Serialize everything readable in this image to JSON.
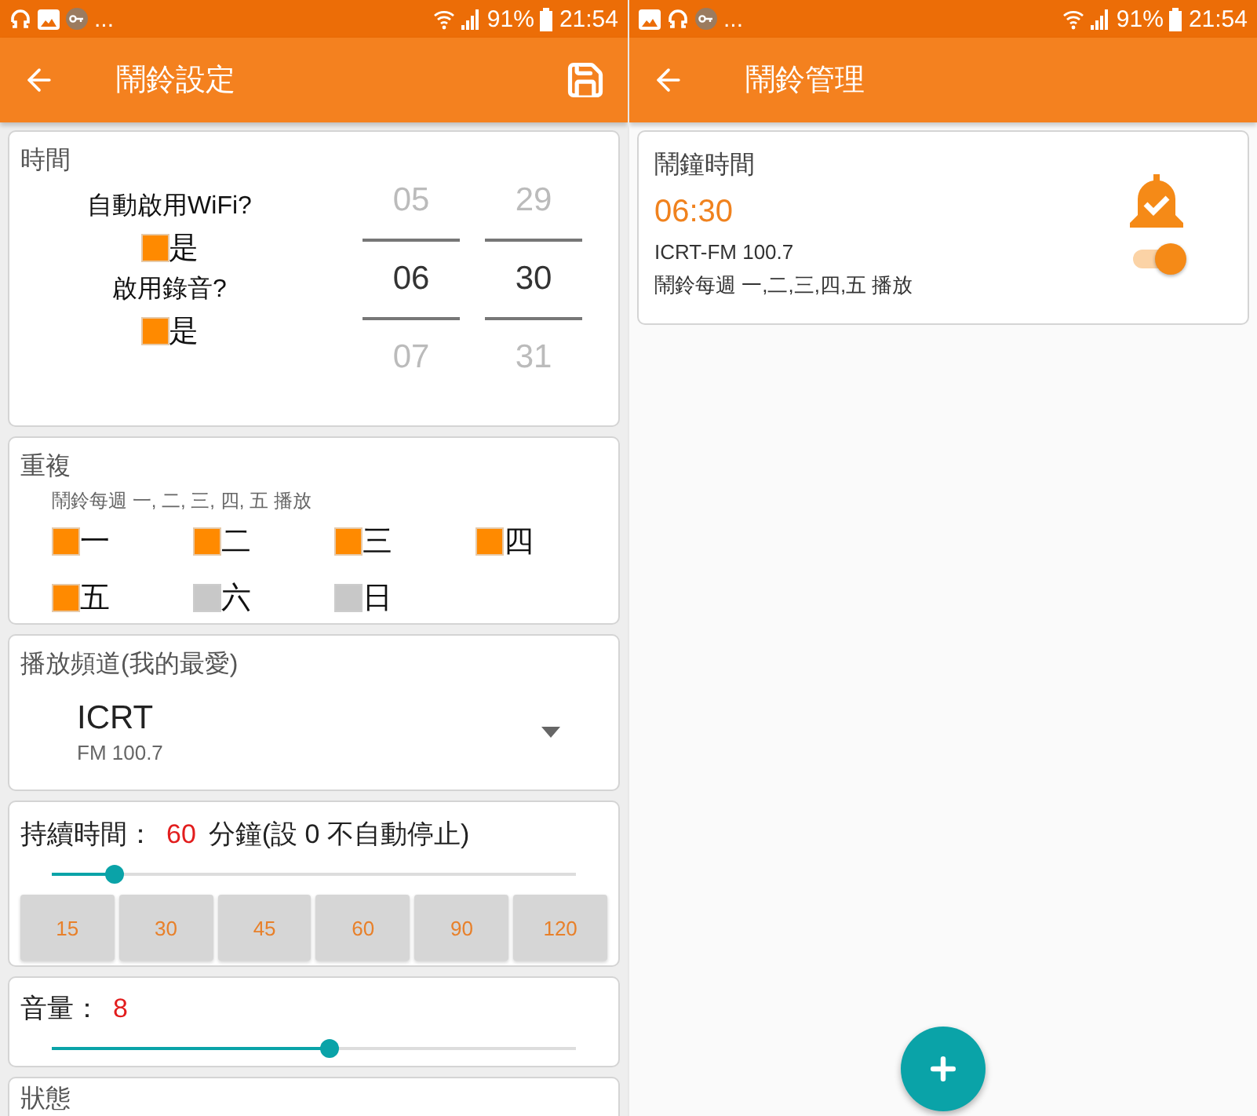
{
  "left": {
    "status_bar": {
      "more": "...",
      "battery": "91%",
      "time": "21:54"
    },
    "app_bar": {
      "title": "鬧鈴設定"
    },
    "time_card": {
      "title": "時間",
      "options": [
        {
          "label": "自動啟用WiFi?",
          "checkbox_label": "是",
          "checked": true
        },
        {
          "label": "啟用錄音?",
          "checkbox_label": "是",
          "checked": true
        }
      ],
      "hour_picker": [
        "05",
        "06",
        "07"
      ],
      "minute_picker": [
        "29",
        "30",
        "31"
      ]
    },
    "repeat_card": {
      "title": "重複",
      "summary": "鬧鈴每週 一, 二, 三, 四, 五 播放",
      "days": [
        {
          "label": "一",
          "checked": true
        },
        {
          "label": "二",
          "checked": true
        },
        {
          "label": "三",
          "checked": true
        },
        {
          "label": "四",
          "checked": true
        },
        {
          "label": "五",
          "checked": true
        },
        {
          "label": "六",
          "checked": false
        },
        {
          "label": "日",
          "checked": false
        }
      ]
    },
    "channel_card": {
      "title": "播放頻道(我的最愛)",
      "name": "ICRT",
      "frequency": "FM 100.7"
    },
    "duration_card": {
      "label": "持續時間：",
      "value": "60",
      "suffix": "分鐘(設 0 不自動停止)",
      "level": 0.12,
      "presets": [
        "15",
        "30",
        "45",
        "60",
        "90",
        "120"
      ]
    },
    "volume_card": {
      "label": "音量：",
      "value": "8",
      "level": 0.53
    },
    "status_card": {
      "title": "狀態"
    }
  },
  "right": {
    "status_bar": {
      "more": "...",
      "battery": "91%",
      "time": "21:54"
    },
    "app_bar": {
      "title": "鬧鈴管理"
    },
    "alarms": [
      {
        "title": "鬧鐘時間",
        "time": "06:30",
        "channel": "ICRT-FM 100.7",
        "summary": "鬧鈴每週 一,二,三,四,五 播放",
        "on": true
      }
    ]
  }
}
